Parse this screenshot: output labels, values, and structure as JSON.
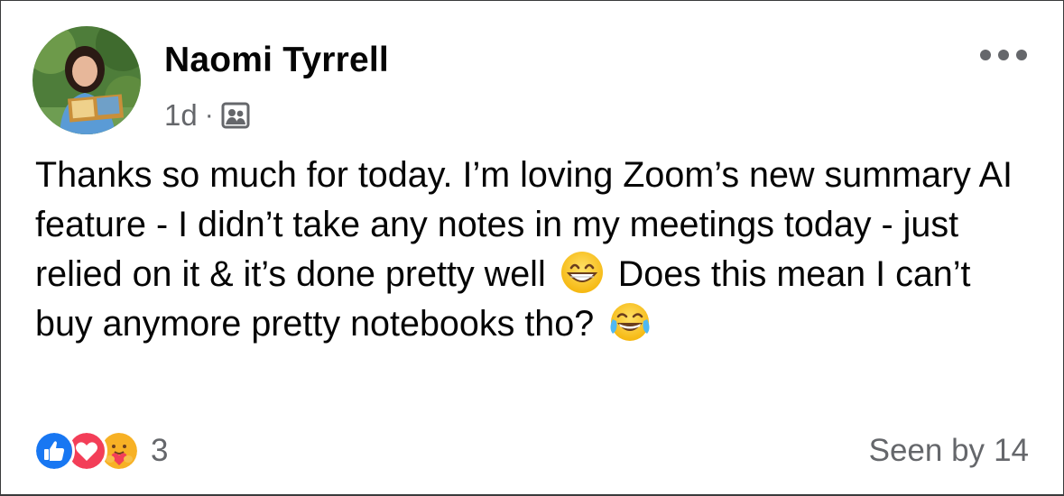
{
  "post": {
    "author_name": "Naomi Tyrrell",
    "time_ago": "1d",
    "separator": "·",
    "audience_icon": "group-members-icon",
    "more_icon": "more-options-icon",
    "text_segments": {
      "part1": "Thanks so much for today. I’m loving Zoom’s new summary AI feature - I didn’t take any notes in my meetings today - just relied on it & it’s done pretty well",
      "part2": "Does this mean I can’t buy anymore pretty notebooks tho?"
    },
    "emojis": [
      "grinning-face-emoji",
      "tears-of-joy-emoji"
    ]
  },
  "footer": {
    "reactions": [
      "like-icon",
      "love-icon",
      "care-icon"
    ],
    "reaction_count": "3",
    "seen_by_label": "Seen by",
    "seen_by_count": "14"
  },
  "colors": {
    "text": "#050505",
    "secondary_text": "#65676b",
    "like_blue": "#1877f2",
    "love_red": "#f33e58",
    "care_yellow": "#f7b125",
    "background": "#ffffff"
  }
}
